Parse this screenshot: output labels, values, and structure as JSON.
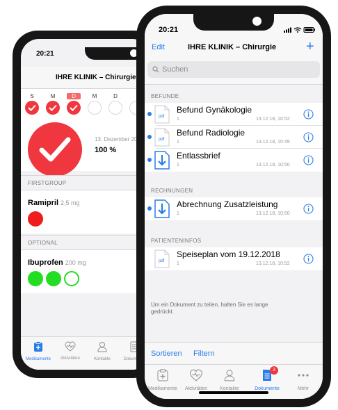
{
  "back_phone": {
    "time": "20:21",
    "nav_title": "IHRE KLINIK – Chirurgie",
    "days": [
      {
        "label": "S",
        "state": "done"
      },
      {
        "label": "M",
        "state": "done"
      },
      {
        "label": "D",
        "state": "done",
        "active": true
      },
      {
        "label": "M",
        "state": "open"
      },
      {
        "label": "D",
        "state": "open"
      }
    ],
    "date_text": "13. Dezember 2018",
    "percent": "100 %",
    "sections": [
      {
        "title": "FIRSTGROUP",
        "meds": [
          {
            "name": "Ramipril",
            "dose": "2,5 mg",
            "pills": [
              "red"
            ]
          }
        ]
      },
      {
        "title": "OPTIONAL",
        "meds": [
          {
            "name": "Ibuprofen",
            "dose": "200 mg",
            "pills": [
              "green",
              "green",
              "empty"
            ]
          }
        ]
      }
    ],
    "tabs": [
      {
        "label": "Medikamente",
        "icon": "medication-icon",
        "active": true
      },
      {
        "label": "Aktivitäten",
        "icon": "heart-icon"
      },
      {
        "label": "Kontakte",
        "icon": "person-icon"
      },
      {
        "label": "Dokumente",
        "icon": "document-icon"
      }
    ]
  },
  "front_phone": {
    "time": "20:21",
    "nav": {
      "edit_label": "Edit",
      "title": "IHRE KLINIK – Chirurgie",
      "add_label": "+"
    },
    "search_placeholder": "Suchen",
    "sections": [
      {
        "title": "BEFUNDE",
        "rows": [
          {
            "title": "Befund Gynäkologie",
            "count": "1",
            "date": "13.12.18, 10:52",
            "icon": "pdf",
            "unread": true
          },
          {
            "title": "Befund Radiologie",
            "count": "1",
            "date": "13.12.18, 10:49",
            "icon": "pdf",
            "unread": true
          },
          {
            "title": "Entlassbrief",
            "count": "1",
            "date": "13.12.18, 10:50",
            "icon": "download",
            "unread": true
          }
        ]
      },
      {
        "title": "RECHNUNGEN",
        "rows": [
          {
            "title": "Abrechnung Zusatzleistung",
            "count": "1",
            "date": "13.12.18, 10:50",
            "icon": "download",
            "unread": true
          }
        ]
      },
      {
        "title": "PATIENTENINFOS",
        "rows": [
          {
            "title": "Speiseplan vom 19.12.2018",
            "count": "1",
            "date": "13.12.18, 10:52",
            "icon": "pdf",
            "unread": false
          }
        ]
      }
    ],
    "hint": "Um ein Dokument zu teilen, halten Sie es lange gedrückt.",
    "toolbar": {
      "sort_label": "Sortieren",
      "filter_label": "Filtern"
    },
    "tabs": [
      {
        "label": "Medikamente",
        "icon": "medication-icon"
      },
      {
        "label": "Aktivitäten",
        "icon": "heart-icon"
      },
      {
        "label": "Kontakte",
        "icon": "person-icon"
      },
      {
        "label": "Dokumente",
        "icon": "document-icon",
        "active": true,
        "badge": "3"
      },
      {
        "label": "Mehr",
        "icon": "more-icon"
      }
    ]
  },
  "colors": {
    "accent": "#2a7de6",
    "red": "#f0363e",
    "green": "#22dd22",
    "pdf": "#2a7de6"
  }
}
